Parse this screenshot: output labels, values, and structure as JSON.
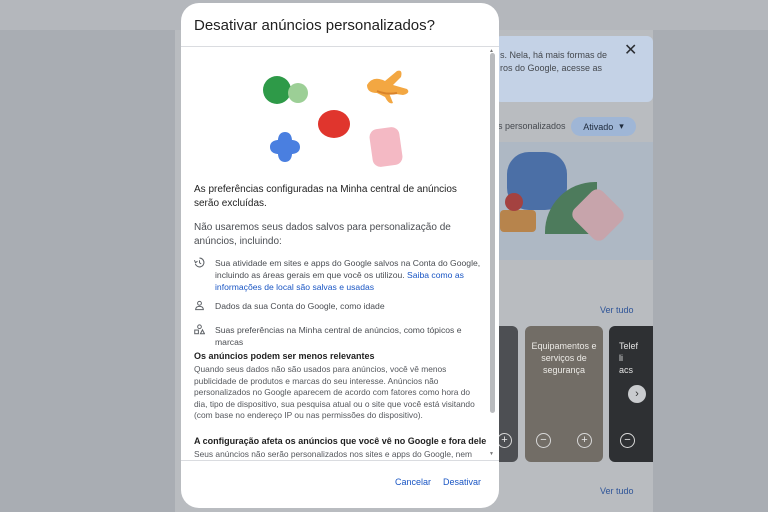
{
  "background": {
    "notice_text": "s. Nela, há mais formas de\nros do Google, acesse as",
    "notice_close": "✕",
    "toggle_label": "s personalizados",
    "toggle_state": "Ativado",
    "toggle_caret": "▾",
    "see_all_1": "Ver tudo",
    "see_all_2": "Ver tudo",
    "card2_title": "Equipamentos e serviços de segurança",
    "card3_title": "Telef\nli\nacs",
    "carousel_next": "›",
    "card_minus": "−",
    "card_plus": "+"
  },
  "dialog": {
    "title": "Desativar anúncios personalizados?",
    "bold_intro": "As preferências configuradas na Minha central de anúncios serão excluídas.",
    "not_used": "Não usaremos seus dados salvos para personalização de anúncios, incluindo:",
    "items": [
      {
        "icon": "history-icon",
        "text": "Sua atividade em sites e apps do Google salvos na Conta do Google, incluindo as áreas gerais em que você os utilizou. ",
        "link": "Saiba como as informações de local são salvas e usadas"
      },
      {
        "icon": "person-icon",
        "text": "Dados da sua Conta do Google, como idade"
      },
      {
        "icon": "shapes-icon",
        "text": "Suas preferências na Minha central de anúncios, como tópicos e marcas"
      }
    ],
    "section1_title": "Os anúncios podem ser menos relevantes",
    "section1_text": "Quando seus dados não são usados para anúncios, você vê menos publicidade de produtos e marcas do seu interesse. Anúncios não personalizados no Google aparecem de acordo com fatores como hora do dia, tipo de dispositivo, sua pesquisa atual ou o site que você está visitando (com base no endereço IP ou nas permissões do dispositivo).",
    "section2_title": "A configuração afeta os anúncios que você vê no Google e fora dele",
    "section2_text": "Seus anúncios não serão personalizados nos sites e apps do Google, nem de",
    "cancel_label": "Cancelar",
    "confirm_label": "Desativar"
  },
  "colors": {
    "link": "#1a56c4",
    "illustration_green": "#2e9a48",
    "illustration_red": "#e0352d",
    "illustration_blue": "#4a7fe0",
    "illustration_orange": "#f3a742",
    "illustration_pink": "#f4b9c4"
  }
}
